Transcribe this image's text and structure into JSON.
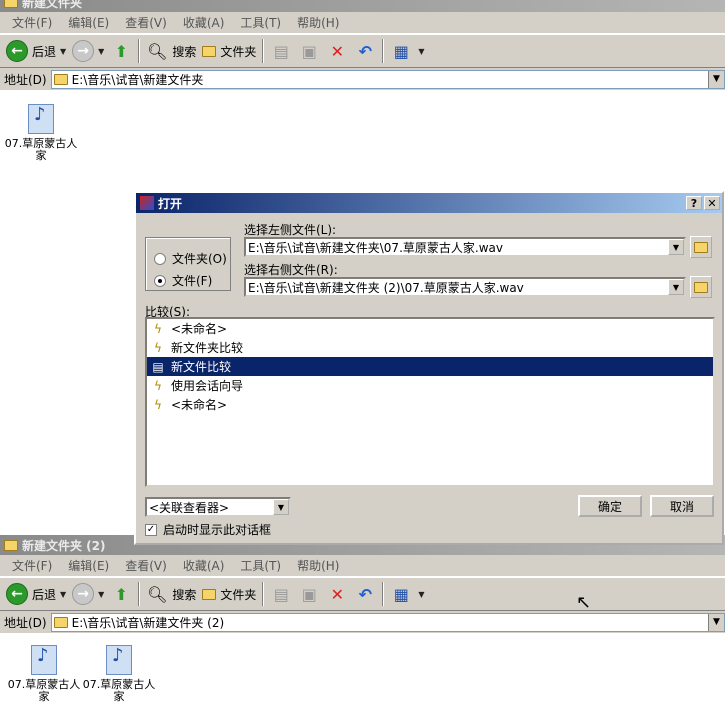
{
  "win1": {
    "title": "新建文件夹",
    "menu": [
      "文件(F)",
      "编辑(E)",
      "查看(V)",
      "收藏(A)",
      "工具(T)",
      "帮助(H)"
    ],
    "toolbar": {
      "back": "后退",
      "search": "搜索",
      "folders": "文件夹"
    },
    "address_label": "地址(D)",
    "address_value": "E:\\音乐\\试音\\新建文件夹",
    "files": [
      "07.草原蒙古人家"
    ]
  },
  "win2": {
    "title": "新建文件夹 (2)",
    "menu": [
      "文件(F)",
      "编辑(E)",
      "查看(V)",
      "收藏(A)",
      "工具(T)",
      "帮助(H)"
    ],
    "toolbar": {
      "back": "后退",
      "search": "搜索",
      "folders": "文件夹"
    },
    "address_label": "地址(D)",
    "address_value": "E:\\音乐\\试音\\新建文件夹 (2)",
    "files": [
      "07.草原蒙古人家",
      "07.草原蒙古人家"
    ]
  },
  "dialog": {
    "title": "打开",
    "help_btn": "?",
    "close_btn": "✕",
    "radio_folder": "文件夹(O)",
    "radio_file": "文件(F)",
    "left_label": "选择左侧文件(L):",
    "left_value": "E:\\音乐\\试音\\新建文件夹\\07.草原蒙古人家.wav",
    "right_label": "选择右侧文件(R):",
    "right_value": "E:\\音乐\\试音\\新建文件夹 (2)\\07.草原蒙古人家.wav",
    "compare_label": "比较(S):",
    "compare_items": [
      {
        "label": "<未命名>",
        "icon": "lightning-icon"
      },
      {
        "label": "新文件夹比较",
        "icon": "folder-compare-icon"
      },
      {
        "label": "新文件比较",
        "icon": "file-compare-icon"
      },
      {
        "label": "使用会话向导",
        "icon": "wizard-icon"
      },
      {
        "label": "<未命名>",
        "icon": "lightning-icon"
      }
    ],
    "selected_index": 2,
    "viewer_select": "<关联查看器>",
    "ok": "确定",
    "cancel": "取消",
    "startup_check": "启动时显示此对话框"
  }
}
